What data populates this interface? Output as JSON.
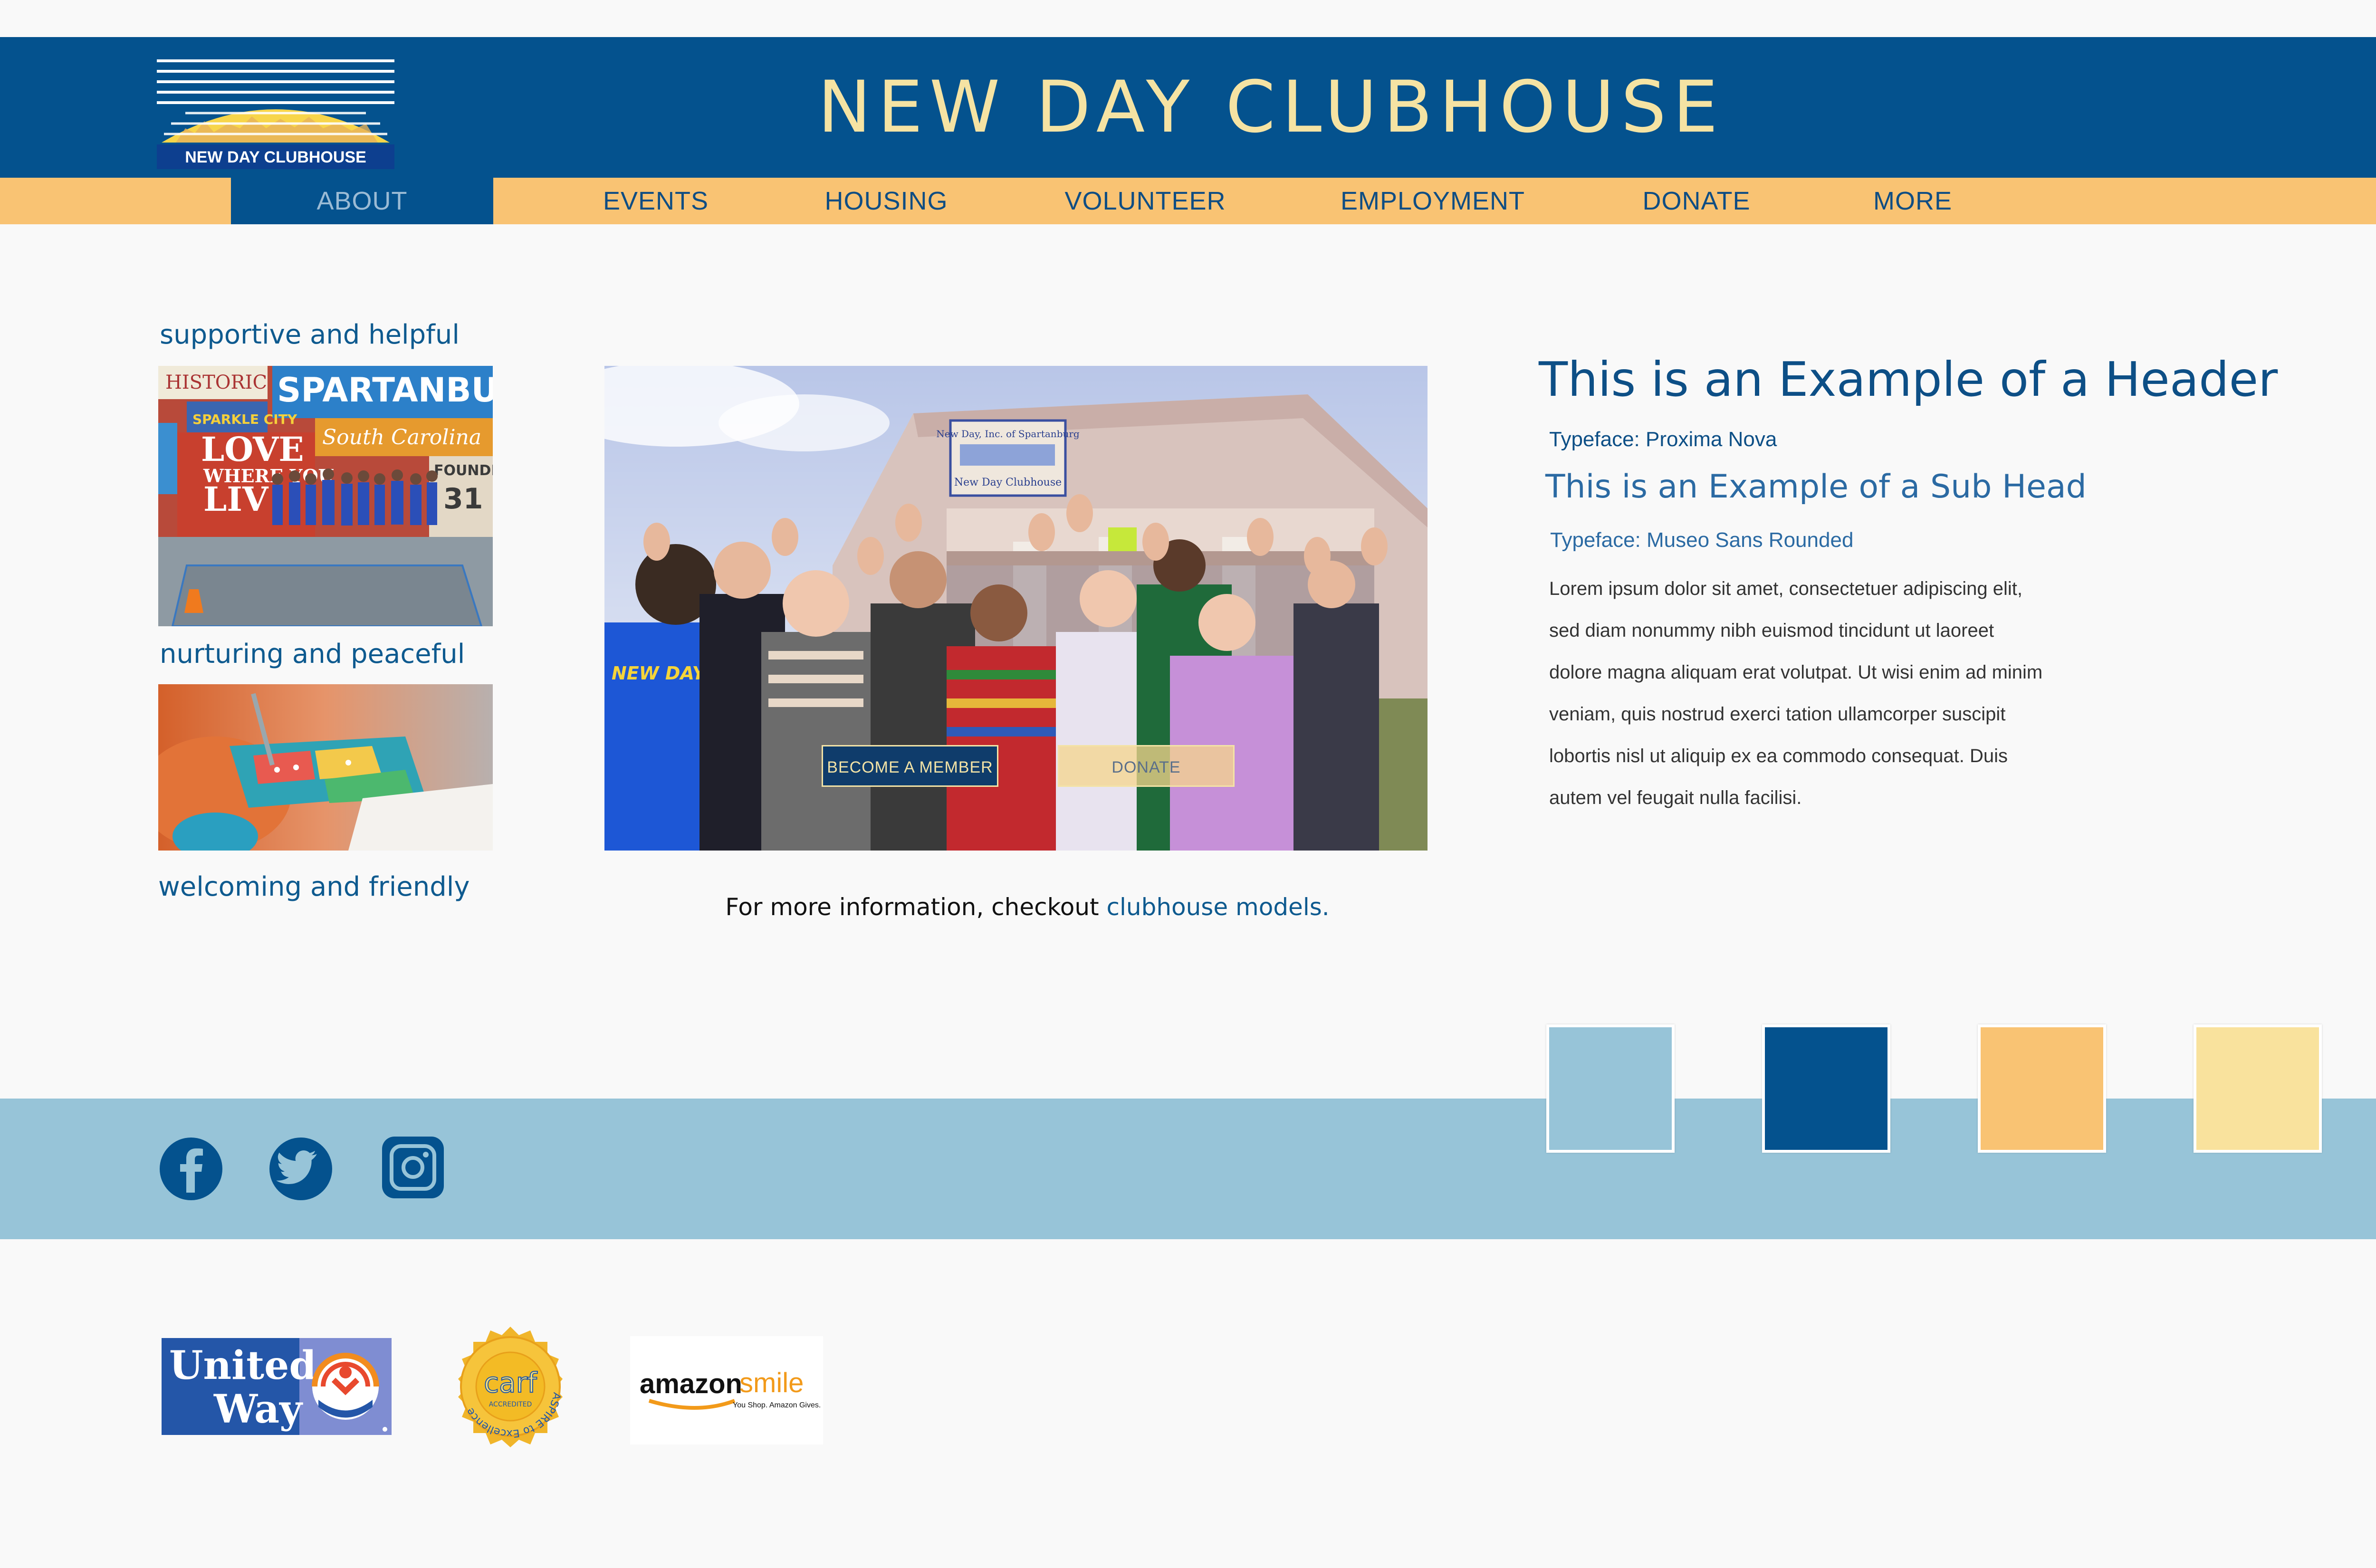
{
  "header": {
    "logo_text": "NEW DAY CLUBHOUSE",
    "site_title": "NEW DAY CLUBHOUSE"
  },
  "nav": {
    "items": [
      {
        "label": "ABOUT",
        "active": true
      },
      {
        "label": "EVENTS"
      },
      {
        "label": "HOUSING"
      },
      {
        "label": "VOLUNTEER"
      },
      {
        "label": "EMPLOYMENT"
      },
      {
        "label": "DONATE"
      },
      {
        "label": "MORE"
      }
    ]
  },
  "left": {
    "taglines": [
      "supportive and helpful",
      "nurturing and peaceful",
      "welcoming and friendly"
    ],
    "mural": {
      "words": [
        "HISTORIC",
        "SPARTANBURG",
        "SPARKLE CITY",
        "South Carolina",
        "LOVE",
        "WHERE YOU",
        "LIV",
        "FOUNDED",
        "31"
      ]
    }
  },
  "hero": {
    "building_sign": [
      "New Day, Inc. of Spartanburg",
      "New Day Clubhouse"
    ],
    "shirt_text": "NEW DAY ST",
    "become_member": "BECOME A MEMBER",
    "donate": "DONATE"
  },
  "info": {
    "prefix": "For more information, checkout ",
    "link": "clubhouse models."
  },
  "style_guide": {
    "header": "This is an Example of a Header",
    "header_typeface": "Typeface: Proxima Nova",
    "subhead": "This is an Example of a Sub Head",
    "subhead_typeface": "Typeface: Museo Sans Rounded",
    "body": [
      "Lorem ipsum dolor sit amet, consectetuer adipiscing elit,",
      "sed diam nonummy nibh euismod tincidunt ut laoreet",
      "dolore magna aliquam erat volutpat. Ut wisi enim ad minim",
      "veniam, quis nostrud exerci tation ullamcorper suscipit",
      "lobortis nisl ut aliquip ex ea commodo consequat. Duis",
      "autem vel feugait nulla facilisi."
    ]
  },
  "colors": {
    "palette": [
      "#97c4d8",
      "#04528e",
      "#f9c373",
      "#f9e29d"
    ],
    "header_bg": "#04528e",
    "nav_bg": "#f9c373",
    "band_bg": "#97c4d8"
  },
  "social": [
    "facebook-icon",
    "twitter-icon",
    "instagram-icon"
  ],
  "partners": {
    "united_way": [
      "United",
      "Way"
    ],
    "carf_ring": "ASPIRE to Excellence",
    "carf_logo": "carf",
    "carf_sub": "ACCREDITED",
    "amazon_word": "amazon",
    "amazon_smile": "smile",
    "amazon_tag": "You Shop. Amazon Gives."
  }
}
